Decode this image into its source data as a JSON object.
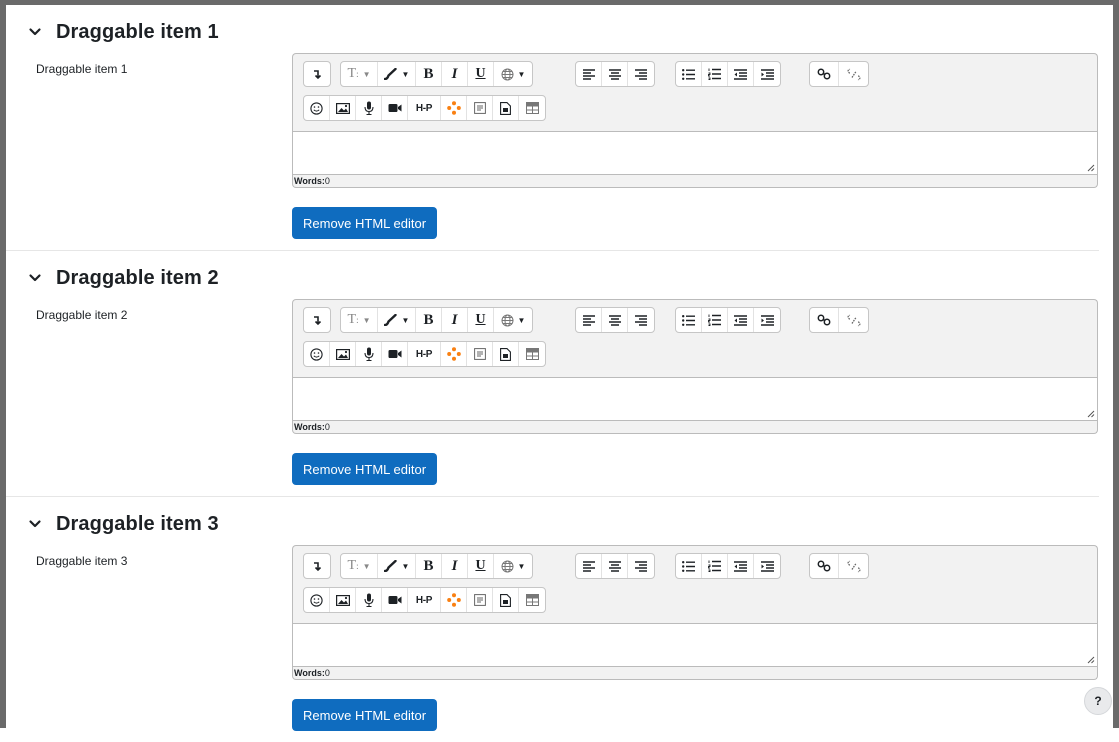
{
  "sections": [
    {
      "title": "Draggable item 1",
      "field_label": "Draggable item 1",
      "word_count_label": "Words:",
      "word_count_value": "0",
      "remove_button": "Remove HTML editor"
    },
    {
      "title": "Draggable item 2",
      "field_label": "Draggable item 2",
      "word_count_label": "Words:",
      "word_count_value": "0",
      "remove_button": "Remove HTML editor"
    },
    {
      "title": "Draggable item 3",
      "field_label": "Draggable item 3",
      "word_count_label": "Words:",
      "word_count_value": "0",
      "remove_button": "Remove HTML editor"
    }
  ],
  "toolbar": {
    "row1": [
      [
        "show-more-icon"
      ],
      [
        "font-size-icon",
        "font-color-icon",
        "bold-icon",
        "italic-icon",
        "underline-icon",
        "language-icon"
      ],
      [
        "align-left-icon",
        "align-center-icon",
        "align-right-icon"
      ],
      [
        "bullet-list-icon",
        "numbered-list-icon",
        "outdent-icon",
        "indent-icon"
      ],
      [
        "link-icon",
        "unlink-icon"
      ]
    ],
    "row2": [
      "emoji-icon",
      "image-icon",
      "record-audio-icon",
      "record-video-icon",
      "h5p-icon",
      "media-icon",
      "equation-icon",
      "manage-files-icon",
      "table-icon"
    ],
    "glyphs": {
      "bold": "B",
      "italic": "I",
      "underline": "U",
      "h5p": "H-P"
    }
  },
  "help": {
    "label": "?"
  },
  "colors": {
    "primary": "#0f6cbf",
    "toolbar_bg": "#f2f2f2",
    "border": "#bbbbbb",
    "media_orange": "#f98012"
  }
}
